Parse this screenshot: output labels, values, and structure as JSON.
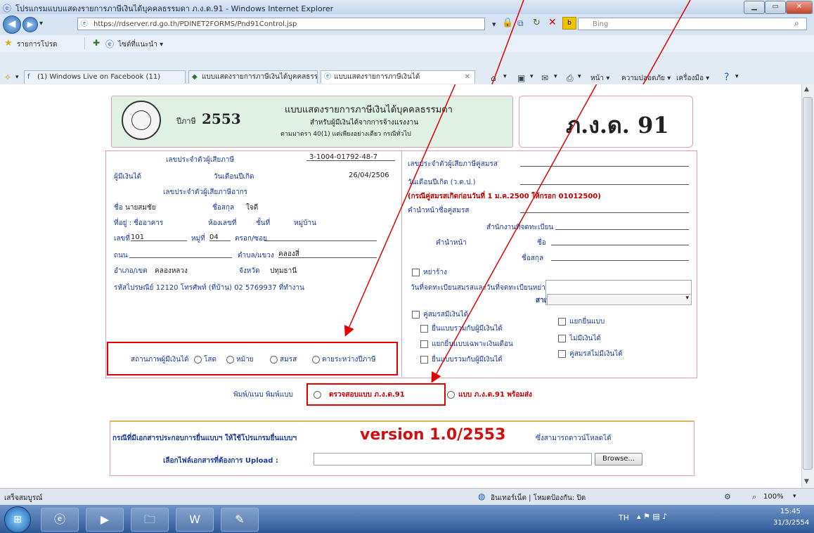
{
  "window": {
    "title": "โปรแกรมแบบแสดงรายการภาษีเงินได้บุคคลธรรมดา ภ.ง.ด.91 - Windows Internet Explorer",
    "minimize": "▁",
    "maximize": "▭",
    "close": "✕"
  },
  "address_bar": {
    "url": "https://rdserver.rd.go.th/PDINET2FORMS/Pnd91Control.jsp",
    "search_placeholder": "Bing"
  },
  "favorites_bar": {
    "favorites_label": "รายการโปรด",
    "suggested_sites": "ไซต์ที่แนะนำ ▾"
  },
  "tabs": [
    {
      "label": "(1) Windows Live on Facebook (11)"
    },
    {
      "label": "แบบแสดงรายการภาษีเงินได้บุคคลธรรมดา"
    },
    {
      "label": "แบบแสดงรายการภาษีเงินได้"
    }
  ],
  "command_bar": {
    "page": "หน้า ▾",
    "safety": "ความปลอดภัย ▾",
    "tools": "เครื่องมือ ▾"
  },
  "form": {
    "tax_year_label": "ปีภาษี",
    "tax_year": "2553",
    "header_title": "แบบแสดงรายการภาษีเงินได้บุคคลธรรมดา",
    "header_sub1": "สำหรับผู้มีเงินได้จากการจ้างแรงงาน",
    "header_sub2": "ตามมาตรา 40(1) แต่เพียงอย่างเดียว กรณีทั่วไป",
    "form_code": "ภ.ง.ด. 91",
    "left": {
      "tax_id_label": "เลขประจำตัวผู้เสียภาษี",
      "tax_id": "3-1004-01792-48-7",
      "taxpayer_label": "ผู้มีเงินได้",
      "birthdate_label": "วันเดือนปีเกิด",
      "birthdate": "26/04/2506",
      "id_card_label": "เลขประจำตัวผู้เสียภาษีอากร",
      "name_label": "ชื่อ",
      "name_value": "นายสมชัย",
      "surname_label": "ชื่อสกุล",
      "surname_value": "ใจดี",
      "address_label": "ที่อยู่ : ชื่ออาคาร",
      "room_label": "ห้องเลขที่",
      "floor_label": "ชั้นที่",
      "village_label": "หมู่บ้าน",
      "house_no_label": "เลขที่",
      "house_no": "101",
      "moo_label": "หมู่ที่",
      "moo": "04",
      "soi_label": "ตรอก/ซอย",
      "road_label": "ถนน",
      "subdistrict_label": "ตำบล/แขวง",
      "subdistrict_value": "คลองสี่",
      "district_label": "อำเภอ/เขต",
      "district_value": "คลองหลวง",
      "province_label": "จังหวัด",
      "province_value": "ปทุมธานี",
      "contact": "รหัสไปรษณีย์ 12120 โทรศัพท์ (ที่บ้าน) 02 5769937 ที่ทำงาน",
      "status_label": "สถานภาพผู้มีเงินได้",
      "status_options": [
        "โสด",
        "หม้าย",
        "สมรส",
        "ตายระหว่างปีภาษี"
      ]
    },
    "right": {
      "spouse_tax_id_label": "เลขประจำตัวผู้เสียภาษีคู่สมรส",
      "spouse_id_label": "วันเดือนปีเกิด (ว.ด.ป.)",
      "spouse_note": "(กรณีคู่สมรสเกิดก่อนวันที่ 1 ม.ค.2500 ให้กรอก 01012500)",
      "spouse_name_label": "คำนำหน้าชื่อคู่สมรส",
      "marriage_label": "สำนักงานที่จดทะเบียน",
      "prefix_label": "คำนำหน้า",
      "name_label": "ชื่อ",
      "surname_label": "ชื่อสกุล",
      "divorce_label": "หย่าร้าง",
      "date_label": "วันที่จดทะเบียนสมรสและวันที่จดทะเบียนหย่าร้าง",
      "reason_label": "สาเหตุ",
      "income_label": "คู่สมรสมีเงินได้",
      "opt1": "ยื่นแบบรวมกับผู้มีเงินได้",
      "opt2": "แยกยื่นแบบเฉพาะเงินเดือน",
      "opt3": "ยื่นแบบรวมกับผู้มีเงินได้",
      "opt4": "แยกยื่นแบบ",
      "opt5": "ไม่มีเงินได้",
      "opt6": "คู่สมรสไม่มีเงินได้"
    },
    "print_label": "พิมพ์/แนบ พิมพ์แบบ",
    "print_opt1": "ตรวจสอบแบบ ภ.ง.ด.91",
    "print_opt2": "แบบ ภ.ง.ด.91 พร้อมส่ง",
    "upload_note": "กรณีที่มีเอกสารประกอบการยื่นแบบฯ ให้ใช้โปรแกรมยื่นแบบฯ",
    "version": "version 1.0/2553",
    "upload_note2": "ซึ่งสามารถดาวน์โหลดได้",
    "upload_label": "เลือกไฟล์เอกสารที่ต้องการ Upload :",
    "browse_button": "Browse..."
  },
  "statusbar": {
    "left": "เสร็จสมบูรณ์",
    "zone": "อินเทอร์เน็ต | โหมดป้องกัน: ปิด",
    "zoom": "100%"
  },
  "taskbar": {
    "lang": "TH",
    "time": "15:45",
    "date": "31/3/2554"
  }
}
